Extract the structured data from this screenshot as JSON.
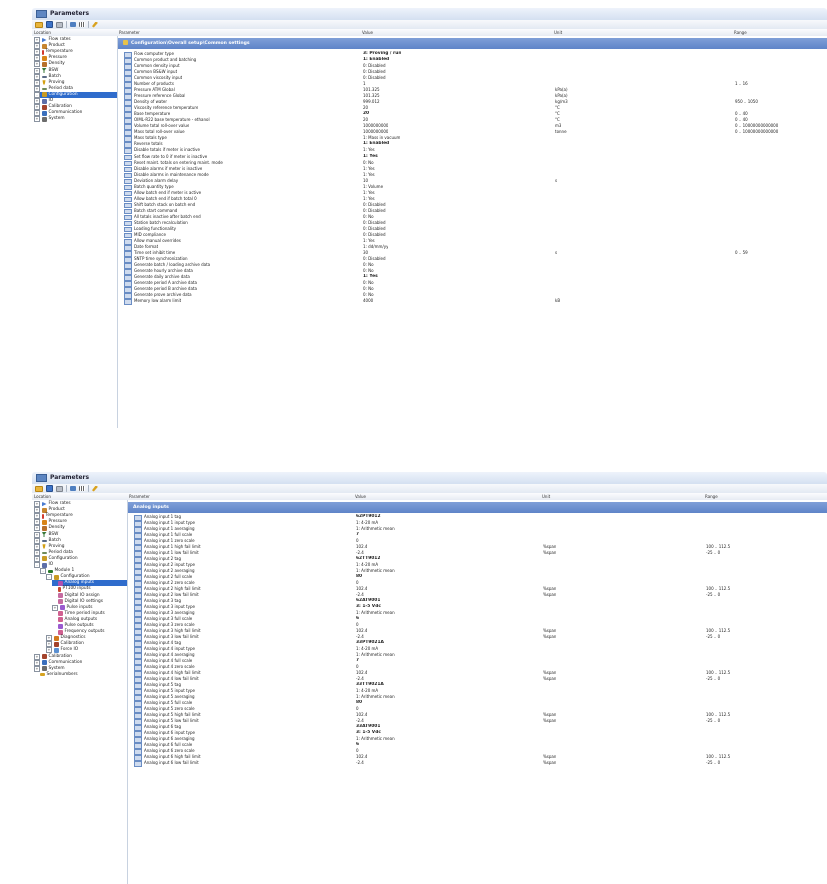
{
  "window1": {
    "title": "Parameters",
    "columns": {
      "location": "Location",
      "parameter": "Parameter",
      "value": "Value",
      "unit": "Unit",
      "range": "Range"
    },
    "tree": [
      {
        "label": "Flow rates",
        "icon": "flow-icon",
        "expand": "+"
      },
      {
        "label": "Product",
        "icon": "product-icon",
        "expand": "+"
      },
      {
        "label": "Temperature",
        "icon": "temperature-icon",
        "expand": "+"
      },
      {
        "label": "Pressure",
        "icon": "pressure-icon",
        "expand": "+"
      },
      {
        "label": "Density",
        "icon": "density-icon",
        "expand": "+"
      },
      {
        "label": "BSW",
        "icon": "bsw-icon",
        "expand": "+"
      },
      {
        "label": "Batch",
        "icon": "batch-icon",
        "expand": "+"
      },
      {
        "label": "Proving",
        "icon": "proving-icon",
        "expand": "+"
      },
      {
        "label": "Period data",
        "icon": "period-icon",
        "expand": "+"
      },
      {
        "label": "Configuration",
        "icon": "configuration-icon",
        "expand": "-",
        "selected": true
      },
      {
        "label": "IO",
        "icon": "io-icon",
        "expand": "+"
      },
      {
        "label": "Calibration",
        "icon": "calibration-icon",
        "expand": "+"
      },
      {
        "label": "Communication",
        "icon": "communication-icon",
        "expand": "+"
      },
      {
        "label": "System",
        "icon": "system-icon",
        "expand": "+"
      }
    ],
    "section": "Configuration\\Overall setup\\Common settings",
    "rows": [
      {
        "p": "Flow computer type",
        "v": "3: Proving / run",
        "u": "",
        "r": "",
        "b": true
      },
      {
        "p": "Common product and batching",
        "v": "1: Enabled",
        "u": "",
        "r": "",
        "b": true
      },
      {
        "p": "Common density input",
        "v": "0: Disabled",
        "u": "",
        "r": ""
      },
      {
        "p": "Common BS&W input",
        "v": "0: Disabled",
        "u": "",
        "r": ""
      },
      {
        "p": "Common viscosity input",
        "v": "0: Disabled",
        "u": "",
        "r": ""
      },
      {
        "p": "Number of products",
        "v": "1",
        "u": "",
        "r": "1 .. 16"
      },
      {
        "p": "Pressure ATM Global",
        "v": "101.325",
        "u": "kPa(a)",
        "r": ""
      },
      {
        "p": "Pressure reference Global",
        "v": "101.325",
        "u": "kPa(a)",
        "r": ""
      },
      {
        "p": "Density of water",
        "v": "999.012",
        "u": "kg/m3",
        "r": "950 .. 1050"
      },
      {
        "p": "Viscosity reference temperature",
        "v": "20",
        "u": "°C",
        "r": ""
      },
      {
        "p": "Base temperature",
        "v": "20",
        "u": "°C",
        "r": "0 .. 40",
        "b": true
      },
      {
        "p": "OIML-R22 base temperature - ethanol",
        "v": "20",
        "u": "°C",
        "r": "0 .. 40"
      },
      {
        "p": "Volume total roll-over value",
        "v": "1000000000",
        "u": "m3",
        "r": "0 .. 10000000000000"
      },
      {
        "p": "Mass total roll-over value",
        "v": "1000000000",
        "u": "tonne",
        "r": "0 .. 10000000000000"
      },
      {
        "p": "Mass totals type",
        "v": "1: Mass in vacuum",
        "u": "",
        "r": ""
      },
      {
        "p": "Reverse totals",
        "v": "1: Enabled",
        "u": "",
        "r": "",
        "b": true
      },
      {
        "p": "Disable totals if meter is inactive",
        "v": "1: Yes",
        "u": "",
        "r": ""
      },
      {
        "p": "Set flow rate to 0 if meter is inactive",
        "v": "1: Yes",
        "u": "",
        "r": "",
        "b": true
      },
      {
        "p": "Reset maint. totals on entering maint. mode",
        "v": "0: No",
        "u": "",
        "r": ""
      },
      {
        "p": "Disable alarms if meter is inactive",
        "v": "1: Yes",
        "u": "",
        "r": ""
      },
      {
        "p": "Disable alarms in maintenance mode",
        "v": "1: Yes",
        "u": "",
        "r": ""
      },
      {
        "p": "Deviation alarm delay",
        "v": "10",
        "u": "s",
        "r": ""
      },
      {
        "p": "Batch quantity type",
        "v": "1: Volume",
        "u": "",
        "r": ""
      },
      {
        "p": "Allow batch end if meter is active",
        "v": "1: Yes",
        "u": "",
        "r": ""
      },
      {
        "p": "Allow batch end if batch total 0",
        "v": "1: Yes",
        "u": "",
        "r": ""
      },
      {
        "p": "Shift batch stack on batch end",
        "v": "0: Disabled",
        "u": "",
        "r": ""
      },
      {
        "p": "Batch start command",
        "v": "0: Disabled",
        "u": "",
        "r": ""
      },
      {
        "p": "All totals inactive after batch end",
        "v": "0: No",
        "u": "",
        "r": ""
      },
      {
        "p": "Station batch recalculation",
        "v": "0: Disabled",
        "u": "",
        "r": ""
      },
      {
        "p": "Loading functionality",
        "v": "0: Disabled",
        "u": "",
        "r": ""
      },
      {
        "p": "MID compliance",
        "v": "0: Disabled",
        "u": "",
        "r": ""
      },
      {
        "p": "Allow manual overrides",
        "v": "1: Yes",
        "u": "",
        "r": ""
      },
      {
        "p": "Date format",
        "v": "1: dd/mm/yy",
        "u": "",
        "r": ""
      },
      {
        "p": "Time set inhibit time",
        "v": "30",
        "u": "s",
        "r": "0 .. 59"
      },
      {
        "p": "SNTP time synchronization",
        "v": "0: Disabled",
        "u": "",
        "r": ""
      },
      {
        "p": "Generate batch / loading archive data",
        "v": "0: No",
        "u": "",
        "r": ""
      },
      {
        "p": "Generate hourly archive data",
        "v": "0: No",
        "u": "",
        "r": ""
      },
      {
        "p": "Generate daily archive data",
        "v": "1: Yes",
        "u": "",
        "r": "",
        "b": true
      },
      {
        "p": "Generate period A archive data",
        "v": "0: No",
        "u": "",
        "r": ""
      },
      {
        "p": "Generate period B archive data",
        "v": "0: No",
        "u": "",
        "r": ""
      },
      {
        "p": "Generate prove archive data",
        "v": "0: No",
        "u": "",
        "r": ""
      },
      {
        "p": "Memory low alarm limit",
        "v": "4000",
        "u": "kB",
        "r": ""
      }
    ]
  },
  "window2": {
    "title": "Parameters",
    "columns": {
      "location": "Location",
      "parameter": "Parameter",
      "value": "Value",
      "unit": "Unit",
      "range": "Range"
    },
    "tree": [
      {
        "label": "Flow rates",
        "icon": "flow-icon",
        "expand": "+",
        "level": 0
      },
      {
        "label": "Product",
        "icon": "product-icon",
        "expand": "+",
        "level": 0
      },
      {
        "label": "Temperature",
        "icon": "temperature-icon",
        "expand": "+",
        "level": 0
      },
      {
        "label": "Pressure",
        "icon": "pressure-icon",
        "expand": "+",
        "level": 0
      },
      {
        "label": "Density",
        "icon": "density-icon",
        "expand": "+",
        "level": 0
      },
      {
        "label": "BSW",
        "icon": "bsw-icon",
        "expand": "+",
        "level": 0
      },
      {
        "label": "Batch",
        "icon": "batch-icon",
        "expand": "+",
        "level": 0
      },
      {
        "label": "Proving",
        "icon": "proving-icon",
        "expand": "+",
        "level": 0
      },
      {
        "label": "Period data",
        "icon": "period-icon",
        "expand": "+",
        "level": 0
      },
      {
        "label": "Configuration",
        "icon": "configuration-icon",
        "expand": "+",
        "level": 0
      },
      {
        "label": "IO",
        "icon": "io-icon",
        "expand": "-",
        "level": 0
      },
      {
        "label": "Module 1",
        "icon": "module-icon",
        "expand": "-",
        "level": 1
      },
      {
        "label": "Configuration",
        "icon": "configuration-icon",
        "expand": "-",
        "level": 2
      },
      {
        "label": "Analog inputs",
        "icon": "analog-inputs-icon",
        "expand": "",
        "level": 3,
        "selected": true
      },
      {
        "label": "PT100 inputs",
        "icon": "pt100-icon",
        "expand": "",
        "level": 3
      },
      {
        "label": "Digital IO assign",
        "icon": "digital-io-icon",
        "expand": "",
        "level": 3
      },
      {
        "label": "Digital IO settings",
        "icon": "digital-io-icon",
        "expand": "",
        "level": 3
      },
      {
        "label": "Pulse inputs",
        "icon": "pulse-icon",
        "expand": "+",
        "level": 3
      },
      {
        "label": "Time period inputs",
        "icon": "time-period-icon",
        "expand": "",
        "level": 3
      },
      {
        "label": "Analog outputs",
        "icon": "analog-outputs-icon",
        "expand": "",
        "level": 3
      },
      {
        "label": "Pulse outputs",
        "icon": "pulse-outputs-icon",
        "expand": "",
        "level": 3
      },
      {
        "label": "Frequency outputs",
        "icon": "frequency-outputs-icon",
        "expand": "",
        "level": 3
      },
      {
        "label": "Diagnostics",
        "icon": "diagnostics-icon",
        "expand": "+",
        "level": 2
      },
      {
        "label": "Calibration",
        "icon": "calibration-icon",
        "expand": "+",
        "level": 2
      },
      {
        "label": "Force IO",
        "icon": "force-io-icon",
        "expand": "+",
        "level": 2
      },
      {
        "label": "Calibration",
        "icon": "calibration-icon",
        "expand": "+",
        "level": 0
      },
      {
        "label": "Communication",
        "icon": "communication-icon",
        "expand": "+",
        "level": 0
      },
      {
        "label": "System",
        "icon": "system-icon",
        "expand": "+",
        "level": 0
      },
      {
        "label": "Serialnumbers",
        "icon": "serialnumbers-icon",
        "expand": "",
        "level": 0
      }
    ],
    "section": "Analog inputs",
    "rows": [
      {
        "p": "Analog input 1 tag",
        "v": "62PT9012",
        "u": "",
        "r": "",
        "b": true
      },
      {
        "p": "Analog input 1 input type",
        "v": "1: 4-20 mA",
        "u": "",
        "r": ""
      },
      {
        "p": "Analog input 1 averaging",
        "v": "1: Arithmetic mean",
        "u": "",
        "r": ""
      },
      {
        "p": "Analog input 1 full scale",
        "v": "7",
        "u": "",
        "r": "",
        "b": true
      },
      {
        "p": "Analog input 1 zero scale",
        "v": "0",
        "u": "",
        "r": ""
      },
      {
        "p": "Analog input 1 high fail limit",
        "v": "102.4",
        "u": "%span",
        "r": "100 .. 112.5"
      },
      {
        "p": "Analog input 1 low fail limit",
        "v": "-2.4",
        "u": "%span",
        "r": "-25 .. 0"
      },
      {
        "p": "Analog input 2 tag",
        "v": "62TT9012",
        "u": "",
        "r": "",
        "b": true
      },
      {
        "p": "Analog input 2 input type",
        "v": "1: 4-20 mA",
        "u": "",
        "r": ""
      },
      {
        "p": "Analog input 2 averaging",
        "v": "1: Arithmetic mean",
        "u": "",
        "r": ""
      },
      {
        "p": "Analog input 2 full scale",
        "v": "80",
        "u": "",
        "r": "",
        "b": true
      },
      {
        "p": "Analog input 2 zero scale",
        "v": "0",
        "u": "",
        "r": ""
      },
      {
        "p": "Analog input 2 high fail limit",
        "v": "102.4",
        "u": "%span",
        "r": "100 .. 112.5"
      },
      {
        "p": "Analog input 2 low fail limit",
        "v": "-2.4",
        "u": "%span",
        "r": "-25 .. 0"
      },
      {
        "p": "Analog input 3 tag",
        "v": "62AT9001",
        "u": "",
        "r": "",
        "b": true
      },
      {
        "p": "Analog input 3 input type",
        "v": "3: 1-5 Vdc",
        "u": "",
        "r": "",
        "b": true
      },
      {
        "p": "Analog input 3 averaging",
        "v": "1: Arithmetic mean",
        "u": "",
        "r": ""
      },
      {
        "p": "Analog input 3 full scale",
        "v": "6",
        "u": "",
        "r": "",
        "b": true
      },
      {
        "p": "Analog input 3 zero scale",
        "v": "0",
        "u": "",
        "r": ""
      },
      {
        "p": "Analog input 3 high fail limit",
        "v": "102.4",
        "u": "%span",
        "r": "100 .. 112.5"
      },
      {
        "p": "Analog input 3 low fail limit",
        "v": "-2.4",
        "u": "%span",
        "r": "-25 .. 0"
      },
      {
        "p": "Analog input 4 tag",
        "v": "33PT9021A",
        "u": "",
        "r": "",
        "b": true
      },
      {
        "p": "Analog input 4 input type",
        "v": "1: 4-20 mA",
        "u": "",
        "r": ""
      },
      {
        "p": "Analog input 4 averaging",
        "v": "1: Arithmetic mean",
        "u": "",
        "r": ""
      },
      {
        "p": "Analog input 4 full scale",
        "v": "7",
        "u": "",
        "r": "",
        "b": true
      },
      {
        "p": "Analog input 4 zero scale",
        "v": "0",
        "u": "",
        "r": ""
      },
      {
        "p": "Analog input 4 high fail limit",
        "v": "102.4",
        "u": "%span",
        "r": "100 .. 112.5"
      },
      {
        "p": "Analog input 4 low fail limit",
        "v": "-2.4",
        "u": "%span",
        "r": "-25 .. 0"
      },
      {
        "p": "Analog input 5 tag",
        "v": "33TT9021A",
        "u": "",
        "r": "",
        "b": true
      },
      {
        "p": "Analog input 5 input type",
        "v": "1: 4-20 mA",
        "u": "",
        "r": ""
      },
      {
        "p": "Analog input 5 averaging",
        "v": "1: Arithmetic mean",
        "u": "",
        "r": ""
      },
      {
        "p": "Analog input 5 full scale",
        "v": "80",
        "u": "",
        "r": "",
        "b": true
      },
      {
        "p": "Analog input 5 zero scale",
        "v": "0",
        "u": "",
        "r": ""
      },
      {
        "p": "Analog input 5 high fail limit",
        "v": "102.4",
        "u": "%span",
        "r": "100 .. 112.5"
      },
      {
        "p": "Analog input 5 low fail limit",
        "v": "-2.4",
        "u": "%span",
        "r": "-25 .. 0"
      },
      {
        "p": "Analog input 6 tag",
        "v": "33AT9001",
        "u": "",
        "r": "",
        "b": true
      },
      {
        "p": "Analog input 6 input type",
        "v": "3: 1-5 Vdc",
        "u": "",
        "r": "",
        "b": true
      },
      {
        "p": "Analog input 6 averaging",
        "v": "1: Arithmetic mean",
        "u": "",
        "r": ""
      },
      {
        "p": "Analog input 6 full scale",
        "v": "6",
        "u": "",
        "r": "",
        "b": true
      },
      {
        "p": "Analog input 6 zero scale",
        "v": "0",
        "u": "",
        "r": ""
      },
      {
        "p": "Analog input 6 high fail limit",
        "v": "102.4",
        "u": "%span",
        "r": "100 .. 112.5"
      },
      {
        "p": "Analog input 6 low fail limit",
        "v": "-2.4",
        "u": "%span",
        "r": "-25 .. 0"
      }
    ]
  }
}
